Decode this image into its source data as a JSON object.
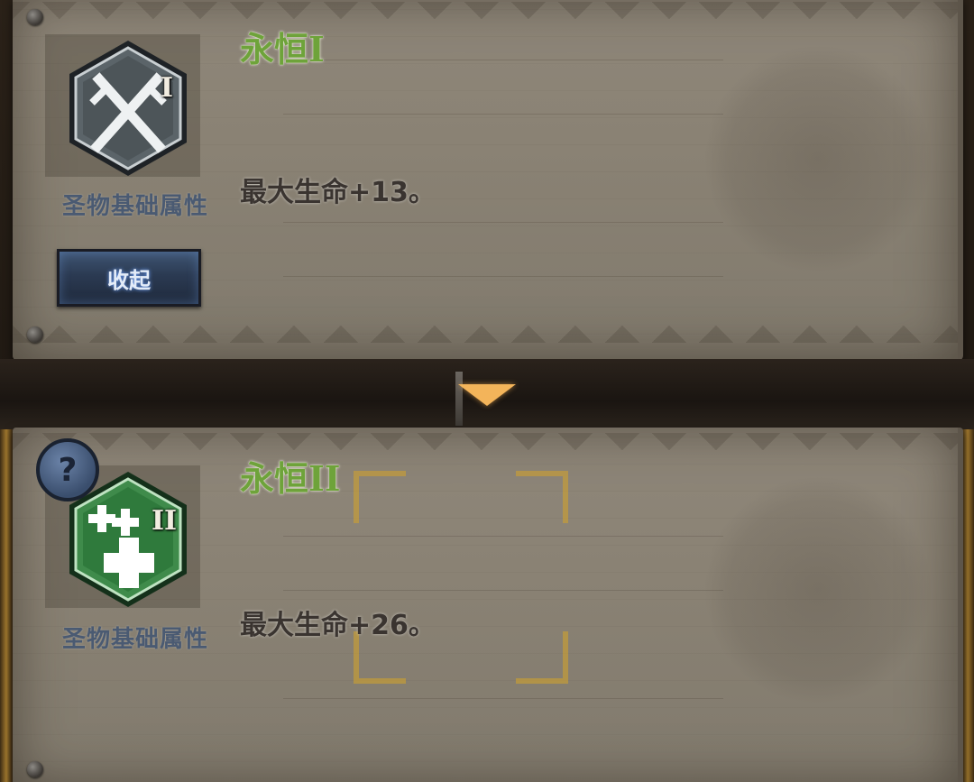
{
  "relics": [
    {
      "title": "永恒I",
      "tier_mark": "I",
      "icon": "crossed-swords-icon",
      "category_label": "圣物基础属性",
      "description": "最大生命+13。"
    },
    {
      "title": "永恒II",
      "tier_mark": "II",
      "icon": "health-cross-icon",
      "category_label": "圣物基础属性",
      "description": "最大生命+26。"
    }
  ],
  "controls": {
    "collapse_label": "收起",
    "help_label": "?"
  },
  "colors": {
    "title_green": "#6ea33a",
    "parchment": "#8a8274",
    "collapse_button": "#2b3a52",
    "arrow": "#f3b45a",
    "relic1_hex": "#4d5559",
    "relic2_hex": "#2f7a3c"
  }
}
